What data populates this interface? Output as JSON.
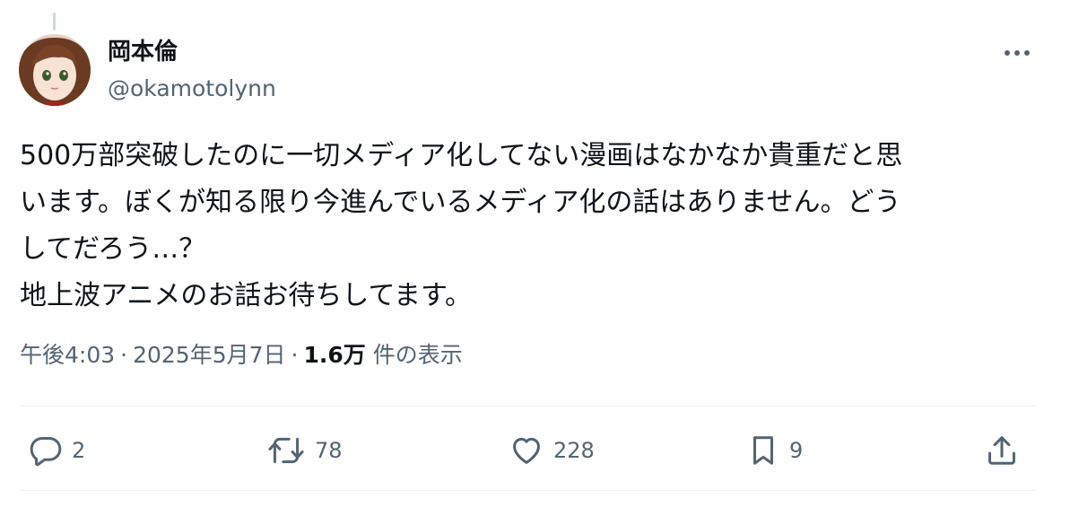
{
  "author": {
    "display_name": "岡本倫",
    "handle": "@okamotolynn"
  },
  "tweet": {
    "lines": [
      "500万部突破したのに一切メディア化してない漫画はなかなか貴重だと思",
      "います。ぼくが知る限り今進んでいるメディア化の話はありません。どう",
      "してだろう…？",
      "地上波アニメのお話お待ちしてます。"
    ]
  },
  "meta": {
    "time": "午後4:03",
    "separator": "·",
    "date": "2025年5月7日",
    "views_count": "1.6万",
    "views_label": "件の表示"
  },
  "actions": {
    "reply_count": "2",
    "retweet_count": "78",
    "like_count": "228",
    "bookmark_count": "9"
  },
  "icons": {
    "more": "more-horizontal-icon",
    "reply": "reply-icon",
    "retweet": "retweet-icon",
    "like": "heart-icon",
    "bookmark": "bookmark-icon",
    "share": "share-icon"
  },
  "colors": {
    "text_primary": "#0f1419",
    "text_secondary": "#536471",
    "divider": "#eff3f4",
    "thread_line": "#cfd9de"
  }
}
